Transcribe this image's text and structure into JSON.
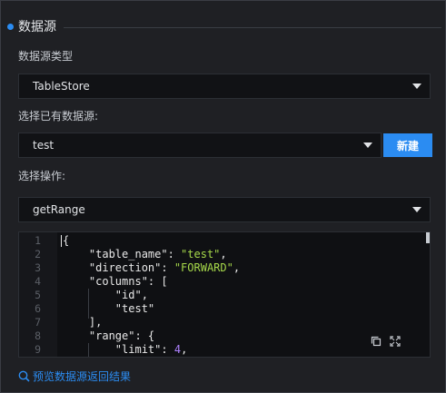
{
  "section": {
    "title": "数据源"
  },
  "datasource_type": {
    "label": "数据源类型",
    "value": "TableStore"
  },
  "existing_datasource": {
    "label": "选择已有数据源:",
    "value": "test",
    "new_button": "新建"
  },
  "operation": {
    "label": "选择操作:",
    "value": "getRange"
  },
  "editor": {
    "line_numbers": [
      "1",
      "2",
      "3",
      "4",
      "5",
      "6",
      "7",
      "8",
      "9"
    ],
    "lines": [
      [
        {
          "t": "{",
          "c": "kw"
        }
      ],
      [
        {
          "t": "    \"table_name\": ",
          "c": "kw"
        },
        {
          "t": "\"test\"",
          "c": "str"
        },
        {
          "t": ",",
          "c": "kw"
        }
      ],
      [
        {
          "t": "    \"direction\": ",
          "c": "kw"
        },
        {
          "t": "\"FORWARD\"",
          "c": "str"
        },
        {
          "t": ",",
          "c": "kw"
        }
      ],
      [
        {
          "t": "    \"columns\": [",
          "c": "kw"
        }
      ],
      [
        {
          "t": "        \"id\",",
          "c": "kw"
        }
      ],
      [
        {
          "t": "        \"test\"",
          "c": "kw"
        }
      ],
      [
        {
          "t": "    ],",
          "c": "kw"
        }
      ],
      [
        {
          "t": "    \"range\": {",
          "c": "kw"
        }
      ],
      [
        {
          "t": "        \"limit\": ",
          "c": "kw"
        },
        {
          "t": "4",
          "c": "num"
        },
        {
          "t": ",",
          "c": "kw"
        }
      ]
    ],
    "copy_icon": "copy-icon",
    "fullscreen_icon": "fullscreen-icon"
  },
  "preview": {
    "icon": "search-icon",
    "label": "预览数据源返回结果"
  },
  "colors": {
    "accent": "#2b8cf2",
    "string": "#a6d84a",
    "number": "#ae81ff"
  }
}
